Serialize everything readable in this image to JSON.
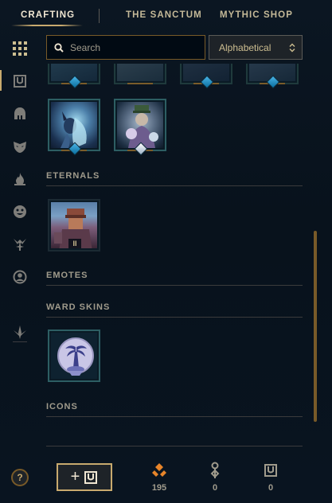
{
  "nav": {
    "tabs": [
      {
        "label": "CRAFTING",
        "active": true
      },
      {
        "label": "THE SANCTUM",
        "active": false
      },
      {
        "label": "MYTHIC SHOP",
        "active": false
      }
    ]
  },
  "sidebar": {
    "items": [
      {
        "icon": "grid-icon",
        "active": true
      },
      {
        "icon": "chest-icon"
      },
      {
        "icon": "champion-helmet-icon"
      },
      {
        "icon": "skin-mask-icon"
      },
      {
        "icon": "flame-icon"
      },
      {
        "icon": "emote-face-icon"
      },
      {
        "icon": "ward-icon"
      },
      {
        "icon": "profile-icon"
      },
      {
        "icon": "arrow-down-icon"
      }
    ],
    "help_label": "?"
  },
  "search": {
    "placeholder": "Search",
    "value": ""
  },
  "sort": {
    "selected": "Alphabetical"
  },
  "sections": {
    "eternals": "ETERNALS",
    "emotes": "EMOTES",
    "ward_skins": "WARD SKINS",
    "icons": "ICONS"
  },
  "eternal_tile": {
    "badge": "II"
  },
  "currencies": [
    {
      "icon": "orange-essence-icon",
      "value": "195"
    },
    {
      "icon": "key-icon",
      "value": "0"
    },
    {
      "icon": "chest-icon",
      "value": "0"
    }
  ],
  "add_button": {
    "label": "+"
  },
  "colors": {
    "gold": "#c8aa6e",
    "dark_gold": "#785a28",
    "background": "#010a13",
    "text": "#a09b8c",
    "accent_blue": "#0ac8b9"
  }
}
